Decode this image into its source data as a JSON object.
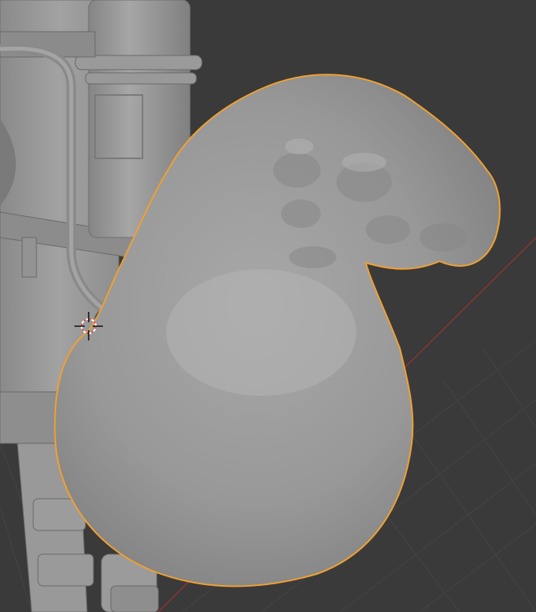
{
  "app": "3D viewport",
  "viewport": {
    "background_color": "#3a3a3a",
    "grid_color": "#444444",
    "x_axis_color": "#a03a3a",
    "selection_outline_color": "#f0a030",
    "mesh_color": "#9a9a9a"
  },
  "objects": {
    "selected": "sack-mesh",
    "other": "character-mesh"
  },
  "cursor": {
    "icon": "3d-cursor-icon"
  }
}
